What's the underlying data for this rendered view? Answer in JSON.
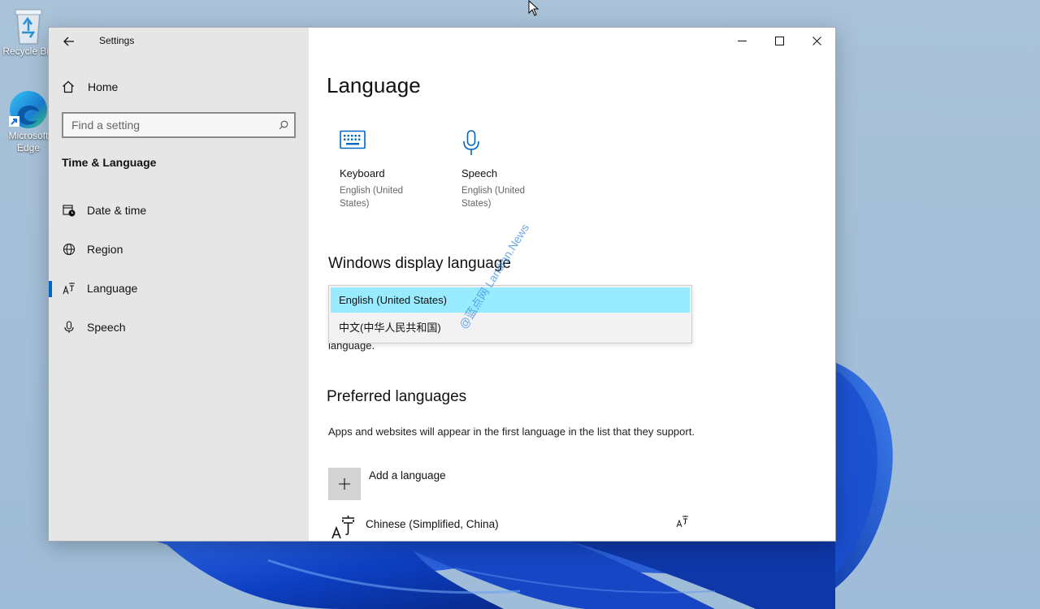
{
  "desktop": {
    "icons": [
      {
        "label": "Recycle Bin",
        "icon": "recycle-bin-icon"
      },
      {
        "label": "Microsoft Edge",
        "icon": "edge-icon"
      }
    ]
  },
  "window": {
    "title": "Settings",
    "controls": {
      "minimize": "minimize-icon",
      "maximize": "maximize-icon",
      "close": "close-icon"
    }
  },
  "sidebar": {
    "home_label": "Home",
    "search_placeholder": "Find a setting",
    "section_title": "Time & Language",
    "items": [
      {
        "label": "Date & time",
        "icon": "clock-calendar-icon",
        "active": false
      },
      {
        "label": "Region",
        "icon": "globe-icon",
        "active": false
      },
      {
        "label": "Language",
        "icon": "language-icon",
        "active": true
      },
      {
        "label": "Speech",
        "icon": "microphone-icon",
        "active": false
      }
    ]
  },
  "main": {
    "title": "Language",
    "tiles": [
      {
        "name": "Keyboard",
        "sub": "English (United States)",
        "icon": "keyboard-icon"
      },
      {
        "name": "Speech",
        "sub": "English (United States)",
        "icon": "microphone-icon"
      }
    ],
    "display_language": {
      "heading": "Windows display language",
      "dropdown_options": [
        "English (United States)",
        "中文(中华人民共和国)"
      ],
      "selected_index": 0,
      "partial_text_behind": "language."
    },
    "preferred": {
      "heading": "Preferred languages",
      "description": "Apps and websites will appear in the first language in the list that they support.",
      "add_label": "Add a language",
      "languages": [
        {
          "name": "Chinese (Simplified, China)"
        }
      ]
    },
    "watermark": "@蓝点网 Landian.News"
  },
  "colors": {
    "accent": "#0067c0",
    "selection": "#99ebff",
    "sidebar_bg": "#e6e6e6",
    "icon_blue": "#0067c0"
  }
}
